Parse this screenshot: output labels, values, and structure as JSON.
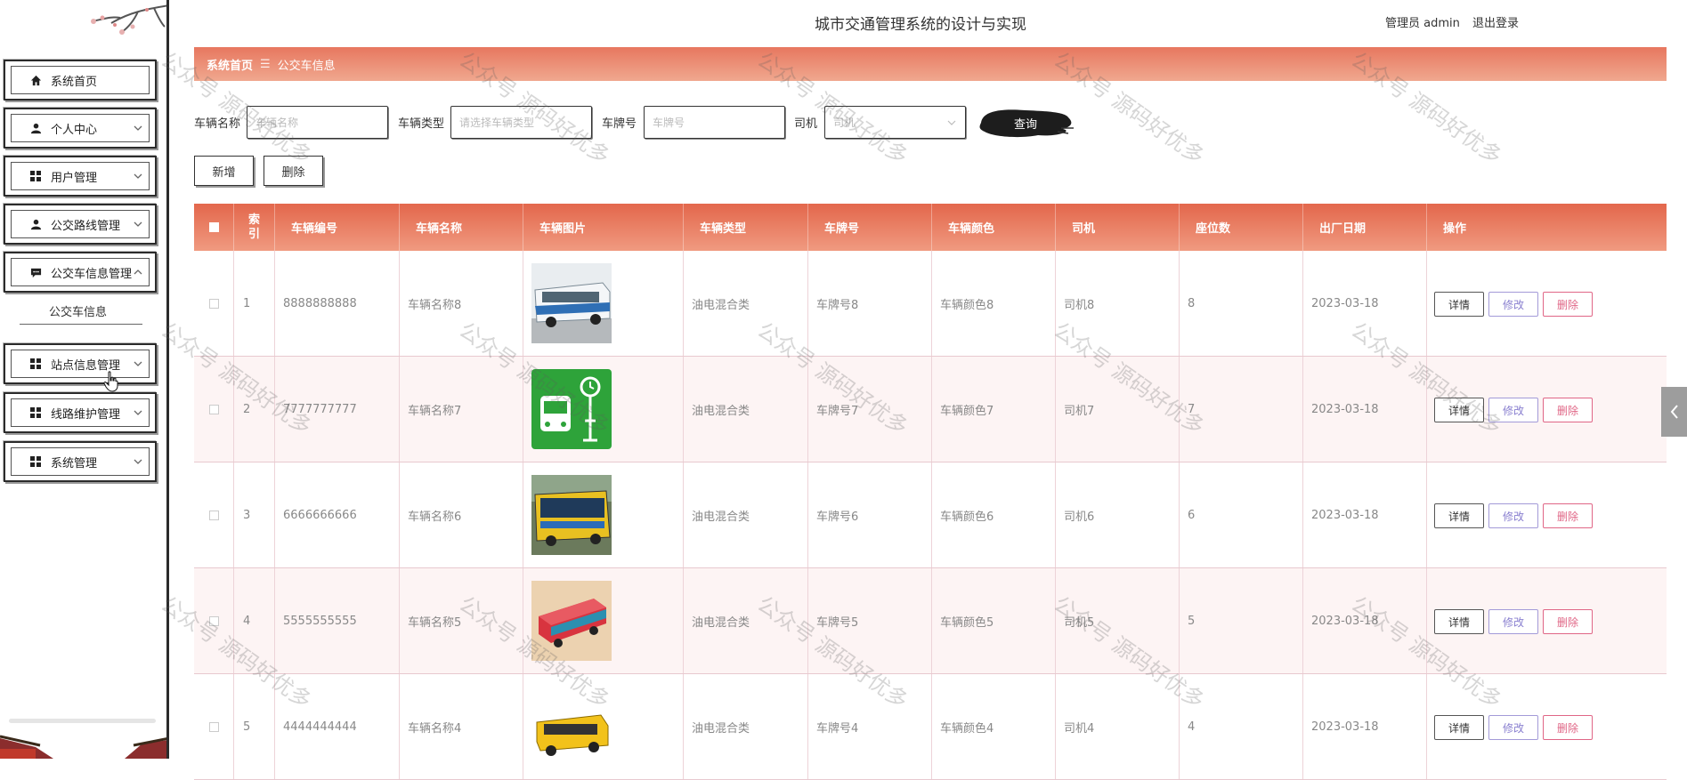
{
  "header": {
    "title": "城市交通管理系统的设计与实现",
    "user_role": "管理员 admin",
    "logout_label": "退出登录"
  },
  "sidebar": {
    "items": [
      {
        "label": "系统首页",
        "icon": "home-icon"
      },
      {
        "label": "个人中心",
        "icon": "person-icon"
      },
      {
        "label": "用户管理",
        "icon": "grid-icon"
      },
      {
        "label": "公交路线管理",
        "icon": "person-icon"
      },
      {
        "label": "公交车信息管理",
        "icon": "chat-icon"
      },
      {
        "label": "站点信息管理",
        "icon": "grid-icon"
      },
      {
        "label": "线路维护管理",
        "icon": "grid-icon"
      },
      {
        "label": "系统管理",
        "icon": "grid-icon"
      }
    ],
    "submenu_item": "公交车信息"
  },
  "breadcrumb": {
    "home": "系统首页",
    "separator": "☰",
    "current": "公交车信息"
  },
  "search": {
    "vehicle_name_label": "车辆名称",
    "vehicle_name_placeholder": "车辆名称",
    "vehicle_type_label": "车辆类型",
    "vehicle_type_placeholder": "请选择车辆类型",
    "plate_label": "车牌号",
    "plate_placeholder": "车牌号",
    "driver_label": "司机",
    "driver_placeholder": "司机",
    "query_label": "查询"
  },
  "actions": {
    "add_label": "新增",
    "delete_label": "删除"
  },
  "table": {
    "columns": [
      "索引",
      "车辆编号",
      "车辆名称",
      "车辆图片",
      "车辆类型",
      "车牌号",
      "车辆颜色",
      "司机",
      "座位数",
      "出厂日期",
      "操作"
    ],
    "rows": [
      {
        "index": "1",
        "code": "8888888888",
        "name": "车辆名称8",
        "type": "油电混合类",
        "plate": "车牌号8",
        "color": "车辆颜色8",
        "driver": "司机8",
        "seats": "8",
        "date": "2023-03-18",
        "image": "city-bus-white-blue"
      },
      {
        "index": "2",
        "code": "7777777777",
        "name": "车辆名称7",
        "type": "油电混合类",
        "plate": "车牌号7",
        "color": "车辆颜色7",
        "driver": "司机7",
        "seats": "7",
        "date": "2023-03-18",
        "image": "bus-stop-green-icon"
      },
      {
        "index": "3",
        "code": "6666666666",
        "name": "车辆名称6",
        "type": "油电混合类",
        "plate": "车牌号6",
        "color": "车辆颜色6",
        "driver": "司机6",
        "seats": "6",
        "date": "2023-03-18",
        "image": "city-bus-yellow"
      },
      {
        "index": "4",
        "code": "5555555555",
        "name": "车辆名称5",
        "type": "油电混合类",
        "plate": "车牌号5",
        "color": "车辆颜色5",
        "driver": "司机5",
        "seats": "5",
        "date": "2023-03-18",
        "image": "bus-red-isometric"
      },
      {
        "index": "5",
        "code": "4444444444",
        "name": "车辆名称4",
        "type": "油电混合类",
        "plate": "车牌号4",
        "color": "车辆颜色4",
        "driver": "司机4",
        "seats": "4",
        "date": "2023-03-18",
        "image": "school-bus-yellow"
      }
    ],
    "row_actions": {
      "detail": "详情",
      "edit": "修改",
      "delete": "删除"
    }
  },
  "watermark_text": "公众号 源码好优多",
  "colors": {
    "header_gradient_start": "#e3674c",
    "header_gradient_end": "#f09a80",
    "edit_button": "#8a80d0",
    "delete_button": "#e06686",
    "sidebar_border": "#2b2b2b"
  }
}
